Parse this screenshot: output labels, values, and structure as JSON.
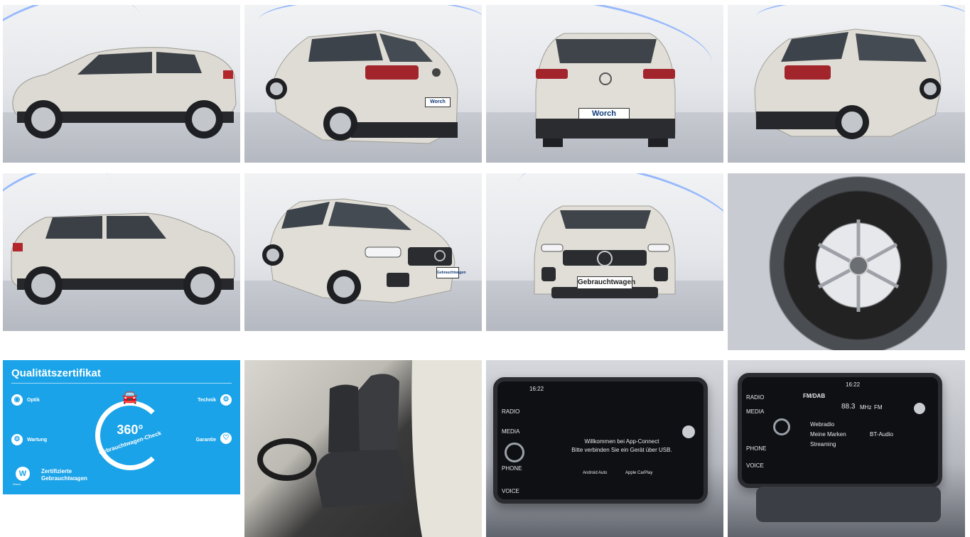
{
  "gallery": {
    "tiles": [
      {
        "name": "car-side-left"
      },
      {
        "name": "car-rear-three-quarter-left"
      },
      {
        "name": "car-rear"
      },
      {
        "name": "car-rear-three-quarter-right"
      },
      {
        "name": "car-side-right"
      },
      {
        "name": "car-front-three-quarter"
      },
      {
        "name": "car-front"
      },
      {
        "name": "car-wheel"
      },
      {
        "name": "quality-certificate"
      },
      {
        "name": "car-interior-seats"
      },
      {
        "name": "infotainment-screen-app-connect"
      },
      {
        "name": "infotainment-screen-radio"
      }
    ],
    "plates": {
      "dealer": "Worch",
      "front": "Gebrauchtwagen"
    }
  },
  "certificate": {
    "title": "Qualitätszertifikat",
    "badge_number": "360°",
    "badge_text": "Gebrauchtwagen-Check",
    "left_top": {
      "head": "Optik"
    },
    "left_bottom": {
      "head": "Wartung"
    },
    "right_top": {
      "head": "Technik"
    },
    "right_bottom": {
      "head": "Garantie"
    },
    "footer_line1": "Zertifizierte",
    "footer_line2": "Gebrauchtwagen",
    "footer_brand": "Worch",
    "colors": {
      "background": "#1aa3e8"
    }
  },
  "screen1": {
    "time": "16:22",
    "side_radio": "RADIO",
    "side_media": "MEDIA",
    "side_phone": "PHONE",
    "side_voice": "VOICE",
    "welcome1": "Willkommen bei App-Connect",
    "welcome2": "Bitte verbinden Sie ein Gerät über USB.",
    "android": "Android Auto",
    "apple": "Apple CarPlay"
  },
  "screen2": {
    "time": "16:22",
    "side_radio": "RADIO",
    "side_media": "MEDIA",
    "side_phone": "PHONE",
    "side_voice": "VOICE",
    "source": "FM/DAB",
    "frequency": "88.3",
    "unit": "MHz",
    "band": "FM",
    "menu_websites": "Webradio",
    "menu_favorites": "Meine Marken",
    "menu_bt": "BT-Audio",
    "menu_stream": "Streaming"
  }
}
